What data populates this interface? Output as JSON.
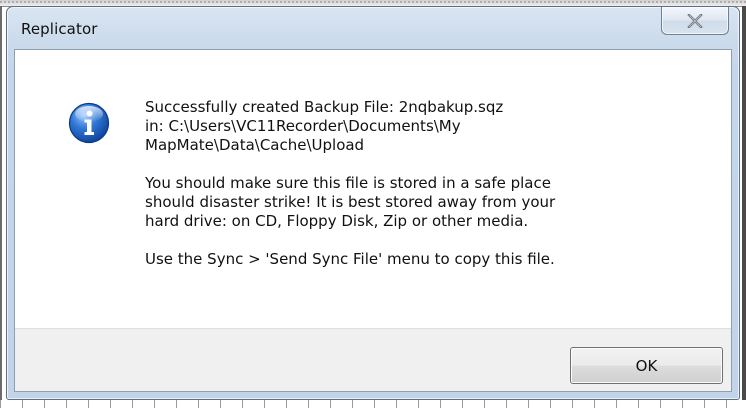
{
  "window": {
    "title": "Replicator",
    "close_icon": "close-icon"
  },
  "dialog": {
    "icon": "info-icon",
    "message": {
      "line1": "Successfully created Backup File: 2nqbakup.sqz\nin: C:\\Users\\VC11Recorder\\Documents\\My\nMapMate\\Data\\Cache\\Upload",
      "line2": "You should make sure this file is stored in a safe place\nshould disaster strike!  It is best stored away from your\nhard drive: on CD, Floppy Disk, Zip or other media.",
      "line3": "Use the Sync > 'Send Sync File' menu to copy this file."
    },
    "ok_label": "OK"
  },
  "colors": {
    "frame": "#c5d6ea",
    "icon_blue": "#1f63c4",
    "button_face": "#e6e6e6"
  }
}
